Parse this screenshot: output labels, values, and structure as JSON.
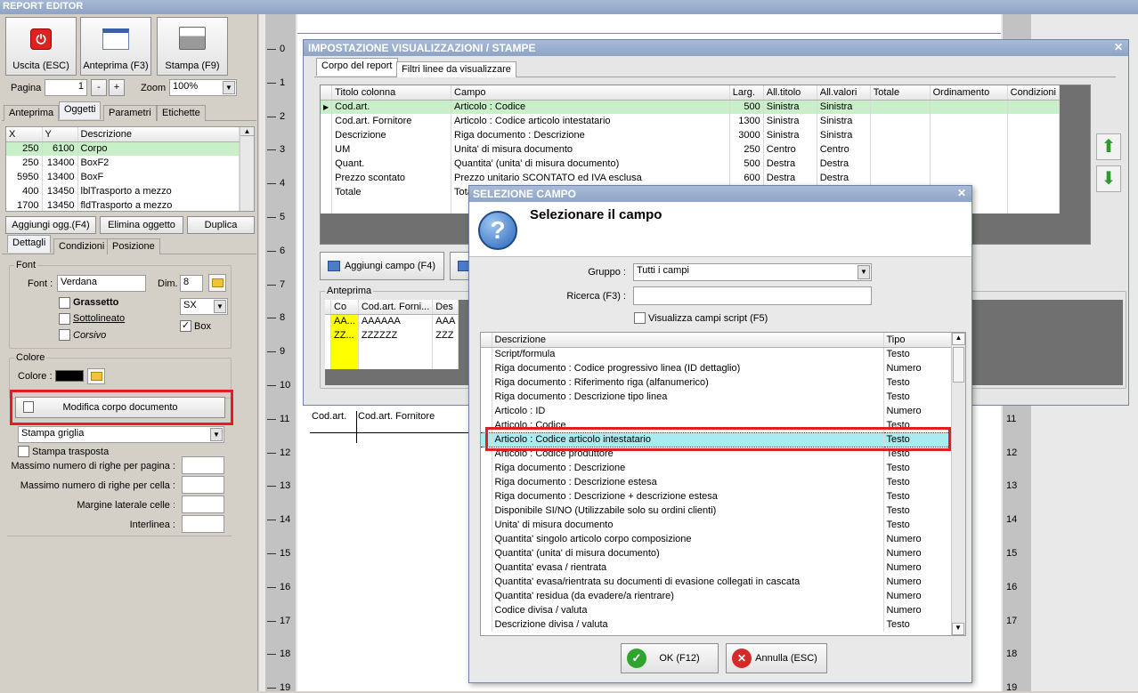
{
  "app": {
    "title": "REPORT EDITOR"
  },
  "toolbar": {
    "exit_label": "Uscita (ESC)",
    "preview_label": "Anteprima (F3)",
    "print_label": "Stampa (F9)"
  },
  "pager": {
    "label": "Pagina",
    "value": "1",
    "minus": "-",
    "plus": "+",
    "zoom_label": "Zoom",
    "zoom_value": "100%"
  },
  "left_tabs": [
    "Anteprima",
    "Oggetti",
    "Parametri",
    "Etichette"
  ],
  "objects_table": {
    "headers": [
      "X",
      "Y",
      "Descrizione"
    ],
    "rows": [
      [
        "250",
        "6100",
        "Corpo"
      ],
      [
        "250",
        "13400",
        "BoxF2"
      ],
      [
        "5950",
        "13400",
        "BoxF"
      ],
      [
        "400",
        "13450",
        "lblTrasporto a mezzo"
      ],
      [
        "1700",
        "13450",
        "fldTrasporto a mezzo"
      ]
    ]
  },
  "object_buttons": {
    "add": "Aggiungi ogg.(F4)",
    "delete": "Elimina oggetto",
    "duplicate": "Duplica"
  },
  "detail_tabs": [
    "Dettagli",
    "Condizioni",
    "Posizione"
  ],
  "font_group": {
    "title": "Font",
    "font_label": "Font :",
    "font_value": "Verdana",
    "dim_label": "Dim.",
    "dim_value": "8",
    "bold": "Grassetto",
    "underline": "Sottolineato",
    "italic": "Corsivo",
    "align_value": "SX",
    "box_label": "Box"
  },
  "color_group": {
    "title": "Colore",
    "label": "Colore :",
    "swatch": "#000000"
  },
  "body_button": "Modifica corpo documento",
  "grid_print": {
    "value": "Stampa griglia",
    "transpose": "Stampa trasposta"
  },
  "params": {
    "max_rows_page": "Massimo numero di righe per pagina :",
    "max_rows_cell": "Massimo numero di righe per cella :",
    "margin": "Margine laterale celle :",
    "line_spacing": "Interlinea :"
  },
  "ruler_numbers": [
    "0",
    "1",
    "2",
    "3",
    "4",
    "5",
    "6",
    "7",
    "8",
    "9",
    "10",
    "11",
    "12",
    "13",
    "14",
    "15",
    "16",
    "17",
    "18",
    "19"
  ],
  "canvas": {
    "col1": "Cod.art.",
    "col2": "Cod.art. Fornitore"
  },
  "settings_dialog": {
    "title": "IMPOSTAZIONE VISUALIZZAZIONI / STAMPE",
    "tabs": [
      "Corpo del report",
      "Filtri linee da visualizzare"
    ],
    "headers": [
      "Titolo colonna",
      "Campo",
      "Larg.",
      "All.titolo",
      "All.valori",
      "Totale",
      "Ordinamento",
      "Condizioni"
    ],
    "rows": [
      [
        "Cod.art.",
        "Articolo : Codice",
        "500",
        "Sinistra",
        "Sinistra",
        "",
        "",
        ""
      ],
      [
        "Cod.art. Fornitore",
        "Articolo : Codice articolo intestatario",
        "1300",
        "Sinistra",
        "Sinistra",
        "",
        "",
        ""
      ],
      [
        "Descrizione",
        "Riga documento : Descrizione",
        "3000",
        "Sinistra",
        "Sinistra",
        "",
        "",
        ""
      ],
      [
        "UM",
        "Unita' di misura documento",
        "250",
        "Centro",
        "Centro",
        "",
        "",
        ""
      ],
      [
        "Quant.",
        "Quantita' (unita' di misura documento)",
        "500",
        "Destra",
        "Destra",
        "",
        "",
        ""
      ],
      [
        "Prezzo scontato",
        "Prezzo unitario SCONTATO ed IVA esclusa",
        "600",
        "Destra",
        "Destra",
        "",
        "",
        ""
      ],
      [
        "Totale",
        "Tota",
        "",
        "",
        "",
        "",
        "",
        ""
      ]
    ],
    "add_field": "Aggiungi campo (F4)",
    "preview_label": "Anteprima",
    "preview_headers": [
      "Co",
      "Cod.art. Forni...",
      "Des"
    ],
    "preview_rows": [
      [
        "AA...",
        "AAAAAA",
        "AAA"
      ],
      [
        "ZZ...",
        "ZZZZZZ",
        "ZZZ"
      ]
    ]
  },
  "field_dialog": {
    "title": "SELEZIONE CAMPO",
    "heading": "Selezionare il campo",
    "group_label": "Gruppo :",
    "group_value": "Tutti i campi",
    "search_label": "Ricerca (F3) :",
    "search_value": "",
    "script_label": "Visualizza campi script (F5)",
    "headers": [
      "Descrizione",
      "Tipo"
    ],
    "rows": [
      [
        "Script/formula",
        "Testo"
      ],
      [
        "Riga documento : Codice progressivo linea (ID dettaglio)",
        "Numero"
      ],
      [
        "Riga documento : Riferimento riga (alfanumerico)",
        "Testo"
      ],
      [
        "Riga documento : Descrizione tipo linea",
        "Testo"
      ],
      [
        "Articolo : ID",
        "Numero"
      ],
      [
        "Articolo : Codice",
        "Testo"
      ],
      [
        "Articolo : Codice articolo intestatario",
        "Testo"
      ],
      [
        "Articolo : Codice produttore",
        "Testo"
      ],
      [
        "Riga documento : Descrizione",
        "Testo"
      ],
      [
        "Riga documento : Descrizione estesa",
        "Testo"
      ],
      [
        "Riga documento : Descrizione + descrizione estesa",
        "Testo"
      ],
      [
        "Disponibile SI/NO (Utilizzabile solo su ordini clienti)",
        "Testo"
      ],
      [
        "Unita' di misura documento",
        "Testo"
      ],
      [
        "Quantita' singolo articolo corpo composizione",
        "Numero"
      ],
      [
        "Quantita' (unita' di misura documento)",
        "Numero"
      ],
      [
        "Quantita' evasa / rientrata",
        "Numero"
      ],
      [
        "Quantita' evasa/rientrata su documenti di evasione collegati in cascata",
        "Numero"
      ],
      [
        "Quantita' residua (da evadere/a rientrare)",
        "Numero"
      ],
      [
        "Codice divisa / valuta",
        "Numero"
      ],
      [
        "Descrizione divisa / valuta",
        "Testo"
      ]
    ],
    "ok_label": "OK (F12)",
    "cancel_label": "Annulla (ESC)"
  },
  "colors": {
    "selection_green": "#c8efc8",
    "selection_cyan": "#a8ecf0",
    "highlight_red": "#e02020",
    "title_blue": "#8ea4c6"
  }
}
